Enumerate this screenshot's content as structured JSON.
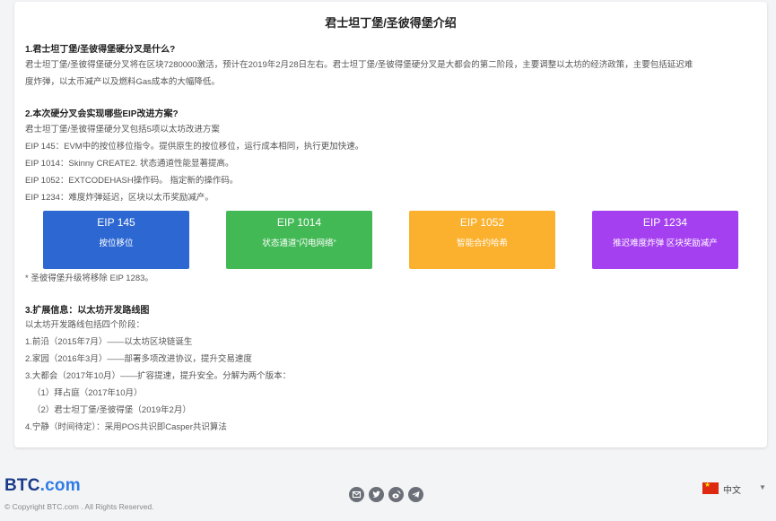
{
  "title": "君士坦丁堡/圣彼得堡介绍",
  "sections": [
    {
      "heading": "1.君士坦丁堡/圣彼得堡硬分叉是什么?",
      "lines": [
        "君士坦丁堡/圣彼得堡硬分叉将在区块7280000激活，预计在2019年2月28日左右。君士坦丁堡/圣彼得堡硬分叉是大都会的第二阶段，主要调整以太坊的经济政策，主要包括延迟难",
        "度炸弹，以太币减产以及燃料Gas成本的大幅降低。"
      ]
    },
    {
      "heading": "2.本次硬分叉会实现哪些EIP改进方案?",
      "lines": [
        "君士坦丁堡/圣彼得堡硬分叉包括5项以太坊改进方案",
        "EIP 145：EVM中的按位移位指令。提供原生的按位移位，运行成本相同，执行更加快速。",
        "EIP 1014：Skinny CREATE2. 状态通道性能显著提高。",
        "EIP 1052：EXTCODEHASH操作码。 指定新的操作码。",
        "EIP 1234：难度炸弹延迟，区块以太币奖励减产。"
      ]
    },
    {
      "heading": "3.扩展信息：以太坊开发路线图",
      "lines": [
        "以太坊开发路线包括四个阶段：",
        "1.前沿（2015年7月）——以太坊区块链诞生",
        "2.家园（2016年3月）——部署多项改进协议，提升交易速度",
        "3.大都会（2017年10月）——扩容提速，提升安全。分解为两个版本：",
        "（1）拜占庭（2017年10月）",
        "（2）君士坦丁堡/圣彼得堡（2019年2月）",
        "4.宁静（时间待定）：采用POS共识即Casper共识算法"
      ]
    }
  ],
  "eip_cards": [
    {
      "name": "EIP 145",
      "desc": "按位移位",
      "color": "#2d68d2"
    },
    {
      "name": "EIP 1014",
      "desc": "状态通道“闪电网络”",
      "color": "#43b955"
    },
    {
      "name": "EIP 1052",
      "desc": "智能合约哈希",
      "color": "#fbb12d"
    },
    {
      "name": "EIP 1234",
      "desc": "推迟难度炸弹 区块奖励减产",
      "color": "#a540f0"
    }
  ],
  "footnote": "* 圣彼得堡升级将移除 EIP 1283。",
  "footer": {
    "logo_main": "BTC",
    "logo_dot": ".com",
    "copyright": "© Copyright BTC.com . All Rights Reserved.",
    "socials": [
      "mail-icon",
      "twitter-icon",
      "weibo-icon",
      "telegram-icon"
    ],
    "language": "中文"
  }
}
